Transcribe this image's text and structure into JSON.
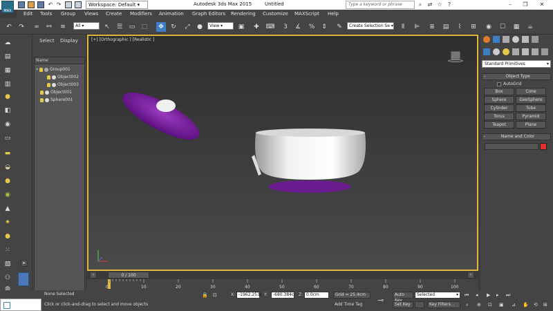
{
  "titlebar": {
    "workspace": "Workspace: Default",
    "app_title": "Autodesk 3ds Max  2015",
    "doc_title": "Untitled",
    "search_placeholder": "Type a keyword or phrase",
    "logo_text": "MAX"
  },
  "menu": [
    "Edit",
    "Tools",
    "Group",
    "Views",
    "Create",
    "Modifiers",
    "Animation",
    "Graph Editors",
    "Rendering",
    "Customize",
    "MAXScript",
    "Help"
  ],
  "toolbar": {
    "selection_filter": "All",
    "ref_coord": "View",
    "selection_set": "Create Selection Se"
  },
  "explorer": {
    "tabs": [
      "Select",
      "Display"
    ],
    "header": "Name",
    "items": [
      {
        "label": "Group001",
        "indent": 0,
        "expanded": true
      },
      {
        "label": "Object002",
        "indent": 1
      },
      {
        "label": "Object003",
        "indent": 1
      },
      {
        "label": "Object001",
        "indent": 0
      },
      {
        "label": "Sphere001",
        "indent": 0
      }
    ]
  },
  "viewport": {
    "label": "[+] [Orthographic ] [Realistic ]"
  },
  "timeline": {
    "slider_label": "0 / 100",
    "ticks": [
      "0",
      "10",
      "20",
      "30",
      "40",
      "50",
      "60",
      "70",
      "80",
      "90",
      "100"
    ]
  },
  "command_panel": {
    "category": "Standard Primitives",
    "object_type_title": "Object Type",
    "autogrid_label": "AutoGrid",
    "primitives": [
      "Box",
      "Cone",
      "Sphere",
      "GeoSphere",
      "Cylinder",
      "Tube",
      "Torus",
      "Pyramid",
      "Teapot",
      "Plane"
    ],
    "name_color_title": "Name and Color",
    "color_swatch": "#e03030"
  },
  "status": {
    "selection": "None Selected",
    "prompt": "Click or click-and-drag to select and move objects",
    "x_label": "X:",
    "x_value": "-1962.253c",
    "y_label": "Y:",
    "y_value": "-680.384c",
    "z_label": "Z:",
    "z_value": "0.0cm",
    "grid": "Grid = 25.4cm",
    "add_time_tag": "Add Time Tag",
    "auto_key": "Auto Key",
    "auto_key_value": "Selected",
    "set_key": "Set Key",
    "key_filters": "Key Filters..."
  },
  "colors": {
    "viewport_border": "#e0b83c",
    "active_tool": "#3d7fc4",
    "purple_object": "#7a1e9e"
  }
}
